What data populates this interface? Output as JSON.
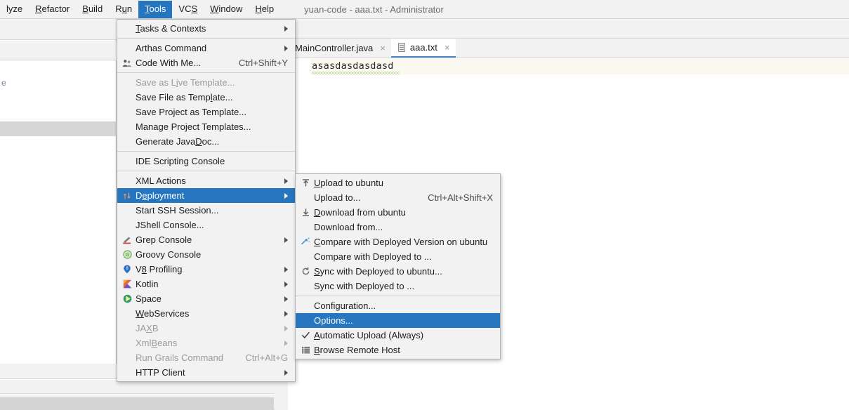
{
  "window": {
    "title": "yuan-code - aaa.txt - Administrator"
  },
  "menubar": {
    "items": [
      {
        "label": "lyze",
        "mnemonic": "",
        "active": false
      },
      {
        "label": "Refactor",
        "mnemonic": "R",
        "active": false
      },
      {
        "label": "Build",
        "mnemonic": "B",
        "active": false
      },
      {
        "label": "Run",
        "mnemonic": "u",
        "active": false
      },
      {
        "label": "Tools",
        "mnemonic": "T",
        "active": true
      },
      {
        "label": "VCS",
        "mnemonic": "S",
        "active": false
      },
      {
        "label": "Window",
        "mnemonic": "W",
        "active": false
      },
      {
        "label": "Help",
        "mnemonic": "H",
        "active": false
      }
    ]
  },
  "tools_menu": {
    "items": [
      {
        "label": "Tasks & Contexts",
        "icon": "",
        "accel": "",
        "submenu": true,
        "selected": false,
        "disabled": false,
        "separator_after": true
      },
      {
        "label": "Arthas Command",
        "icon": "",
        "accel": "",
        "submenu": true,
        "selected": false,
        "disabled": false
      },
      {
        "label": "Code With Me...",
        "icon": "people-icon",
        "accel": "Ctrl+Shift+Y",
        "submenu": false,
        "selected": false,
        "disabled": false,
        "separator_after": true
      },
      {
        "label": "Save as Live Template...",
        "icon": "",
        "accel": "",
        "submenu": false,
        "selected": false,
        "disabled": true
      },
      {
        "label": "Save File as Template...",
        "icon": "",
        "accel": "",
        "submenu": false,
        "selected": false,
        "disabled": false
      },
      {
        "label": "Save Project as Template...",
        "icon": "",
        "accel": "",
        "submenu": false,
        "selected": false,
        "disabled": false
      },
      {
        "label": "Manage Project Templates...",
        "icon": "",
        "accel": "",
        "submenu": false,
        "selected": false,
        "disabled": false
      },
      {
        "label": "Generate JavaDoc...",
        "icon": "",
        "accel": "",
        "submenu": false,
        "selected": false,
        "disabled": false,
        "separator_after": true
      },
      {
        "label": "IDE Scripting Console",
        "icon": "",
        "accel": "",
        "submenu": false,
        "selected": false,
        "disabled": false,
        "separator_after": true
      },
      {
        "label": "XML Actions",
        "icon": "",
        "accel": "",
        "submenu": true,
        "selected": false,
        "disabled": false
      },
      {
        "label": "Deployment",
        "icon": "deployment-icon",
        "accel": "",
        "submenu": true,
        "selected": true,
        "disabled": false
      },
      {
        "label": "Start SSH Session...",
        "icon": "",
        "accel": "",
        "submenu": false,
        "selected": false,
        "disabled": false
      },
      {
        "label": "JShell Console...",
        "icon": "",
        "accel": "",
        "submenu": false,
        "selected": false,
        "disabled": false
      },
      {
        "label": "Grep Console",
        "icon": "grep-console-icon",
        "accel": "",
        "submenu": true,
        "selected": false,
        "disabled": false
      },
      {
        "label": "Groovy Console",
        "icon": "groovy-icon",
        "accel": "",
        "submenu": false,
        "selected": false,
        "disabled": false
      },
      {
        "label": "V8 Profiling",
        "icon": "v8-icon",
        "accel": "",
        "submenu": true,
        "selected": false,
        "disabled": false
      },
      {
        "label": "Kotlin",
        "icon": "kotlin-icon",
        "accel": "",
        "submenu": true,
        "selected": false,
        "disabled": false
      },
      {
        "label": "Space",
        "icon": "space-icon",
        "accel": "",
        "submenu": true,
        "selected": false,
        "disabled": false
      },
      {
        "label": "WebServices",
        "icon": "",
        "accel": "",
        "submenu": true,
        "selected": false,
        "disabled": false
      },
      {
        "label": "JAXB",
        "icon": "",
        "accel": "",
        "submenu": true,
        "selected": false,
        "disabled": true
      },
      {
        "label": "XmlBeans",
        "icon": "",
        "accel": "",
        "submenu": true,
        "selected": false,
        "disabled": true
      },
      {
        "label": "Run Grails Command",
        "icon": "",
        "accel": "Ctrl+Alt+G",
        "submenu": false,
        "selected": false,
        "disabled": true
      },
      {
        "label": "HTTP Client",
        "icon": "",
        "accel": "",
        "submenu": true,
        "selected": false,
        "disabled": false
      }
    ]
  },
  "deployment_menu": {
    "items": [
      {
        "label": "Upload to ubuntu",
        "icon": "upload-icon",
        "accel": "",
        "submenu": false,
        "selected": false,
        "disabled": false
      },
      {
        "label": "Upload to...",
        "icon": "",
        "accel": "Ctrl+Alt+Shift+X",
        "submenu": false,
        "selected": false,
        "disabled": false
      },
      {
        "label": "Download from ubuntu",
        "icon": "download-icon",
        "accel": "",
        "submenu": false,
        "selected": false,
        "disabled": false
      },
      {
        "label": "Download from...",
        "icon": "",
        "accel": "",
        "submenu": false,
        "selected": false,
        "disabled": false
      },
      {
        "label": "Compare with Deployed Version on ubuntu",
        "icon": "compare-icon",
        "accel": "",
        "submenu": false,
        "selected": false,
        "disabled": false
      },
      {
        "label": "Compare with Deployed to ...",
        "icon": "",
        "accel": "",
        "submenu": false,
        "selected": false,
        "disabled": false
      },
      {
        "label": "Sync with Deployed to ubuntu...",
        "icon": "sync-icon",
        "accel": "",
        "submenu": false,
        "selected": false,
        "disabled": false
      },
      {
        "label": "Sync with Deployed to ...",
        "icon": "",
        "accel": "",
        "submenu": false,
        "selected": false,
        "disabled": false,
        "separator_after": true
      },
      {
        "label": "Configuration...",
        "icon": "",
        "accel": "",
        "submenu": false,
        "selected": false,
        "disabled": false
      },
      {
        "label": "Options...",
        "icon": "",
        "accel": "",
        "submenu": false,
        "selected": true,
        "disabled": false
      },
      {
        "label": "Automatic Upload (Always)",
        "icon": "check-icon",
        "accel": "",
        "submenu": false,
        "selected": false,
        "disabled": false
      },
      {
        "label": "Browse Remote Host",
        "icon": "remote-host-icon",
        "accel": "",
        "submenu": false,
        "selected": false,
        "disabled": false
      }
    ]
  },
  "editor": {
    "tabs": [
      {
        "label": "MainController.java",
        "active": false,
        "icon": "",
        "close": "×"
      },
      {
        "label": "aaa.txt",
        "active": true,
        "icon": "text-file-icon",
        "close": "×"
      }
    ],
    "code_line": "asasdasdasdasd"
  },
  "left_panel": {
    "stub_text": "e"
  },
  "bottom_toolbar": {
    "icons": [
      {
        "name": "collapse-all-icon"
      },
      {
        "name": "gear-icon"
      },
      {
        "name": "hide-icon"
      }
    ]
  },
  "colors": {
    "accent_blue": "#2675bf",
    "menu_bg": "#f2f2f2",
    "current_line": "#fbf8ef",
    "selected_row": "#d6d6d6",
    "tab_underline": "#4a86c8"
  }
}
